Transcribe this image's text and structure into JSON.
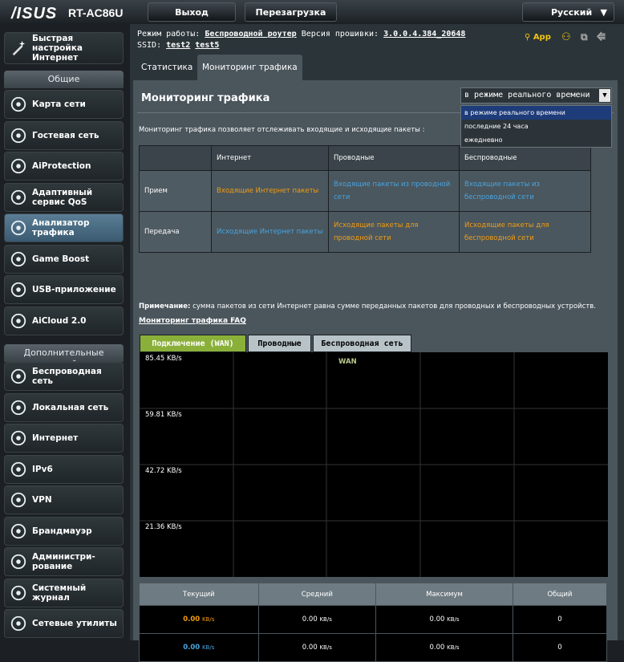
{
  "header": {
    "brand": "/ISUS",
    "model": "RT-AC86U",
    "logout": "Выход",
    "reboot": "Перезагрузка",
    "language": "Русский"
  },
  "info": {
    "mode_label": "Режим работы:",
    "mode_value": "Беспроводной роутер",
    "fw_label": "Версия прошивки:",
    "fw_value": "3.0.0.4.384_20648",
    "ssid_label": "SSID:",
    "ssid1": "test2",
    "ssid2": "test5",
    "app": "App"
  },
  "tabs": {
    "stats": "Статистика",
    "monitor": "Мониторинг трафика"
  },
  "sidebar": {
    "quick": "Быстрая настройка Интернет",
    "general_title": "Общие",
    "general": [
      "Карта сети",
      "Гостевая сеть",
      "AiProtection",
      "Адаптивный сервис QoS",
      "Анализатор трафика",
      "Game Boost",
      "USB-приложение",
      "AiCloud 2.0"
    ],
    "advanced_title": "Дополнительные настройки",
    "advanced": [
      "Беспроводная сеть",
      "Локальная сеть",
      "Интернет",
      "IPv6",
      "VPN",
      "Брандмауэр",
      "Администри-рование",
      "Системный журнал",
      "Сетевые утилиты"
    ]
  },
  "panel": {
    "title": "Мониторинг трафика",
    "select_value": "в режиме реального времени",
    "options": [
      "в режиме реального времени",
      "последние 24 часа",
      "ежедневно"
    ],
    "description": "Мониторинг трафика позволяет отслеживать входящие и исходящие пакеты :",
    "table": {
      "headers": [
        "",
        "Интернет",
        "Проводные",
        "Беспроводные"
      ],
      "rows": [
        {
          "label": "Прием",
          "cells": [
            "Входящие Интернет пакеты",
            "Входящие пакеты из проводной сети",
            "Входящие пакеты из беспроводной сети"
          ]
        },
        {
          "label": "Передача",
          "cells": [
            "Исходящие Интернет пакеты",
            "Исходящие пакеты для проводной сети",
            "Исходящие пакеты для беспроводной сети"
          ]
        }
      ]
    },
    "note_label": "Примечание:",
    "note_text": " сумма пакетов из сети Интернет равна сумме переданных пакетов для проводных и беспроводных устройств.",
    "faq": "Мониторинг трафика FAQ",
    "graph_tabs": [
      "Подключение (WAN)",
      "Проводные",
      "Беспроводная сеть"
    ],
    "graph_legend": "WAN",
    "y_labels": [
      "85.45 KB/s",
      "59.81 KB/s",
      "42.72 KB/s",
      "21.36 KB/s"
    ],
    "stats_headers": [
      "Текущий",
      "Средний",
      "Максимум",
      "Общий"
    ],
    "stats_rows": [
      [
        "0.00",
        "0.00",
        "0.00",
        "0"
      ],
      [
        "0.00",
        "0.00",
        "0.00",
        "0"
      ]
    ],
    "unit": "KB/s"
  },
  "colors": {
    "orange": "#f39c12",
    "blue": "#4aa3df",
    "active_tab": "#8ab03a"
  }
}
